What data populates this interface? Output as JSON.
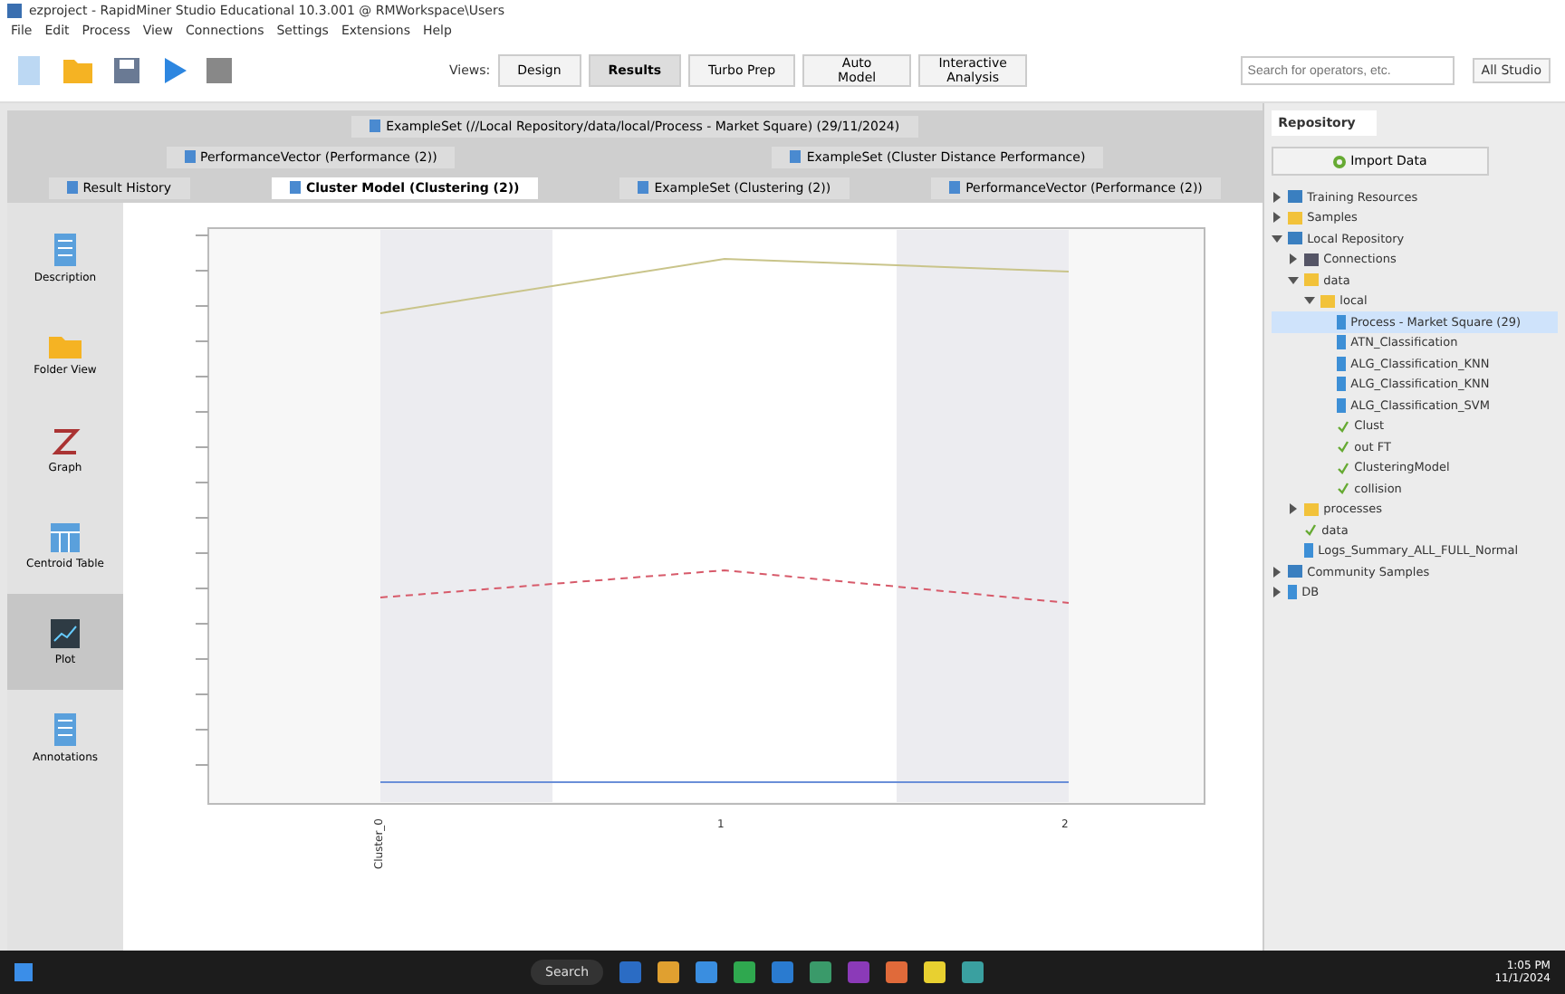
{
  "window": {
    "title": "ezproject - RapidMiner Studio Educational 10.3.001 @ RMWorkspace\\Users"
  },
  "menu": [
    "File",
    "Edit",
    "Process",
    "View",
    "Connections",
    "Settings",
    "Extensions",
    "Help"
  ],
  "views": [
    {
      "label": "Design",
      "selected": false
    },
    {
      "label": "Results",
      "selected": true
    },
    {
      "label": "Turbo Prep",
      "selected": false
    },
    {
      "label": "Auto Model",
      "selected": false
    },
    {
      "label": "Interactive Analysis",
      "selected": false
    }
  ],
  "views_label": "Views:",
  "search": {
    "placeholder": "Search for operators, etc."
  },
  "search_scope": "All Studio",
  "doc_tab_rows": [
    [
      {
        "label": "ExampleSet (//Local Repository/data/local/Process - Market Square) (29/11/2024)",
        "selected": false
      }
    ],
    [
      {
        "label": "PerformanceVector (Performance (2))",
        "selected": false
      },
      {
        "label": "ExampleSet (Cluster Distance Performance)",
        "selected": false
      }
    ],
    [
      {
        "label": "Result History",
        "selected": false
      },
      {
        "label": "Cluster Model (Clustering (2))",
        "selected": true
      },
      {
        "label": "ExampleSet (Clustering (2))",
        "selected": false
      },
      {
        "label": "PerformanceVector (Performance (2))",
        "selected": false
      }
    ]
  ],
  "side_views": [
    {
      "label": "Description",
      "kind": "doc",
      "selected": false
    },
    {
      "label": "Folder View",
      "kind": "folder",
      "selected": false
    },
    {
      "label": "Graph",
      "kind": "graph",
      "selected": false
    },
    {
      "label": "Centroid Table",
      "kind": "table",
      "selected": false
    },
    {
      "label": "Plot",
      "kind": "plot",
      "selected": true
    },
    {
      "label": "Annotations",
      "kind": "doc",
      "selected": false
    }
  ],
  "plot": {
    "x_labels": [
      "Cluster_0",
      "1",
      "2"
    ]
  },
  "repository": {
    "title": "Repository",
    "import_button": "Import Data",
    "tree": [
      {
        "label": "Training Resources",
        "kind": "repo",
        "expanded": false,
        "selected": false
      },
      {
        "label": "Samples",
        "kind": "folder",
        "expanded": false,
        "selected": false
      },
      {
        "label": "Local Repository",
        "kind": "repo",
        "expanded": true,
        "selected": false,
        "children": [
          {
            "label": "Connections",
            "kind": "conn",
            "expanded": false,
            "selected": false
          },
          {
            "label": "data",
            "kind": "folder",
            "expanded": true,
            "selected": false,
            "children": [
              {
                "label": "local",
                "kind": "folder",
                "expanded": true,
                "selected": false,
                "children": [
                  {
                    "label": "Process - Market Square (29)",
                    "kind": "data",
                    "selected": true
                  },
                  {
                    "label": "ATN_Classification",
                    "kind": "data",
                    "selected": false
                  },
                  {
                    "label": "ALG_Classification_KNN",
                    "kind": "data",
                    "selected": false
                  },
                  {
                    "label": "ALG_Classification_KNN",
                    "kind": "data",
                    "selected": false
                  },
                  {
                    "label": "ALG_Classification_SVM",
                    "kind": "data",
                    "selected": false
                  },
                  {
                    "label": "Clust",
                    "kind": "model",
                    "selected": false
                  },
                  {
                    "label": "out FT",
                    "kind": "model",
                    "selected": false
                  },
                  {
                    "label": "ClusteringModel",
                    "kind": "model",
                    "selected": false
                  },
                  {
                    "label": "collision",
                    "kind": "model",
                    "selected": false
                  }
                ]
              }
            ]
          },
          {
            "label": "processes",
            "kind": "folder",
            "expanded": false,
            "selected": false
          },
          {
            "label": "data",
            "kind": "model",
            "selected": false
          },
          {
            "label": "Logs_Summary_ALL_FULL_Normal",
            "kind": "data",
            "selected": false
          }
        ]
      },
      {
        "label": "Community Samples",
        "kind": "repo",
        "expanded": false,
        "selected": false
      },
      {
        "label": "DB",
        "kind": "data",
        "expanded": false,
        "selected": false
      }
    ]
  },
  "taskbar": {
    "search": "Search",
    "time": "1:05 PM",
    "date": "11/1/2024"
  }
}
